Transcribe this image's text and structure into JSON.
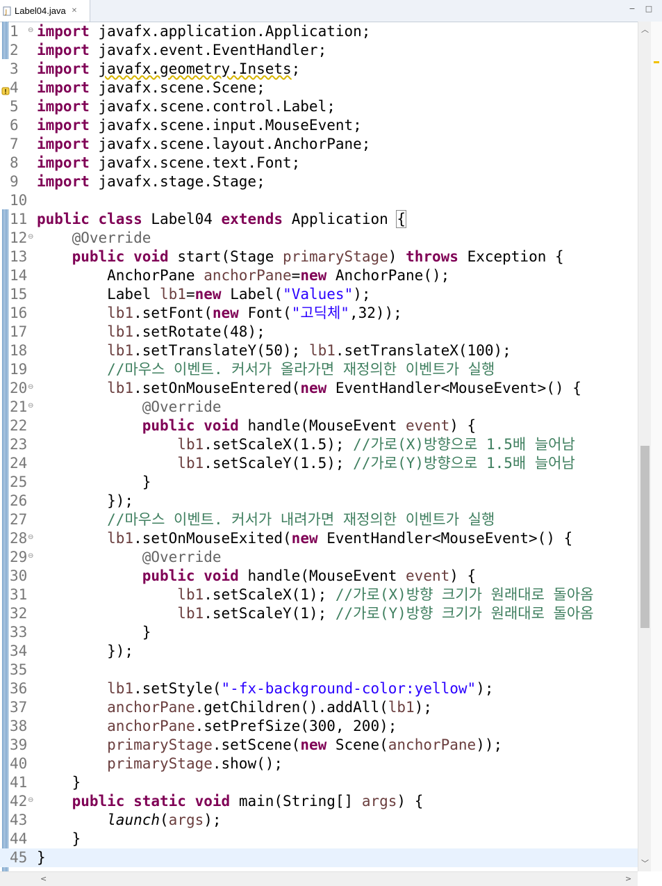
{
  "tab": {
    "title": "Label04.java",
    "close": "✕"
  },
  "window": {
    "minimize": "−",
    "maximize": "□"
  },
  "lines": [
    {
      "n": "1",
      "fold": "⊖",
      "html": "<span class=\"kw\">import</span> javafx.application.Application;"
    },
    {
      "n": "2",
      "fold": "",
      "html": "<span class=\"kw\">import</span> javafx.event.EventHandler;"
    },
    {
      "n": "3",
      "fold": "",
      "html": "<span class=\"kw\">import</span> <span style=\"text-decoration:underline wavy #d7b500\">javafx.geometry.Insets</span>;"
    },
    {
      "n": "4",
      "fold": "",
      "html": "<span class=\"kw\">import</span> javafx.scene.Scene;"
    },
    {
      "n": "5",
      "fold": "",
      "html": "<span class=\"kw\">import</span> javafx.scene.control.Label;"
    },
    {
      "n": "6",
      "fold": "",
      "html": "<span class=\"kw\">import</span> javafx.scene.input.MouseEvent;"
    },
    {
      "n": "7",
      "fold": "",
      "html": "<span class=\"kw\">import</span> javafx.scene.layout.AnchorPane;"
    },
    {
      "n": "8",
      "fold": "",
      "html": "<span class=\"kw\">import</span> javafx.scene.text.Font;"
    },
    {
      "n": "9",
      "fold": "",
      "html": "<span class=\"kw\">import</span> javafx.stage.Stage;"
    },
    {
      "n": "10",
      "fold": "",
      "html": ""
    },
    {
      "n": "11",
      "fold": "",
      "html": "<span class=\"kw\">public</span> <span class=\"kw\">class</span> Label04 <span class=\"kw\">extends</span> Application <span style=\"outline:1px solid #888\">{</span>"
    },
    {
      "n": "12",
      "fold": "⊖",
      "html": "    <span class=\"ann\">@Override</span>"
    },
    {
      "n": "13",
      "fold": "",
      "html": "    <span class=\"kw\">public</span> <span class=\"kw\">void</span> start(Stage <span class=\"fld\">primaryStage</span>) <span class=\"kw\">throws</span> Exception {"
    },
    {
      "n": "14",
      "fold": "",
      "html": "        AnchorPane <span class=\"fld\">anchorPane</span>=<span class=\"kw\">new</span> AnchorPane();"
    },
    {
      "n": "15",
      "fold": "",
      "html": "        Label <span class=\"fld\">lb1</span>=<span class=\"kw\">new</span> Label(<span class=\"str\">\"Values\"</span>);"
    },
    {
      "n": "16",
      "fold": "",
      "html": "        <span class=\"fld\">lb1</span>.setFont(<span class=\"kw\">new</span> Font(<span class=\"str\">\"고딕체\"</span>,32));"
    },
    {
      "n": "17",
      "fold": "",
      "html": "        <span class=\"fld\">lb1</span>.setRotate(48);"
    },
    {
      "n": "18",
      "fold": "",
      "html": "        <span class=\"fld\">lb1</span>.setTranslateY(50); <span class=\"fld\">lb1</span>.setTranslateX(100);"
    },
    {
      "n": "19",
      "fold": "",
      "html": "        <span class=\"cm\">//마우스 이벤트. 커서가 올라가면 재정의한 이벤트가 실행</span>"
    },
    {
      "n": "20",
      "fold": "⊖",
      "html": "        <span class=\"fld\">lb1</span>.setOnMouseEntered(<span class=\"kw\">new</span> EventHandler&lt;MouseEvent&gt;() {"
    },
    {
      "n": "21",
      "fold": "⊖",
      "html": "            <span class=\"ann\">@Override</span>"
    },
    {
      "n": "22",
      "fold": "",
      "html": "            <span class=\"kw\">public</span> <span class=\"kw\">void</span> handle(MouseEvent <span class=\"fld\">event</span>) {"
    },
    {
      "n": "23",
      "fold": "",
      "html": "                <span class=\"fld\">lb1</span>.setScaleX(1.5); <span class=\"cm\">//가로(X)방향으로 1.5배 늘어남</span>"
    },
    {
      "n": "24",
      "fold": "",
      "html": "                <span class=\"fld\">lb1</span>.setScaleY(1.5); <span class=\"cm\">//가로(Y)방향으로 1.5배 늘어남</span>"
    },
    {
      "n": "25",
      "fold": "",
      "html": "            }"
    },
    {
      "n": "26",
      "fold": "",
      "html": "        });"
    },
    {
      "n": "27",
      "fold": "",
      "html": "        <span class=\"cm\">//마우스 이벤트. 커서가 내려가면 재정의한 이벤트가 실행</span>"
    },
    {
      "n": "28",
      "fold": "⊖",
      "html": "        <span class=\"fld\">lb1</span>.setOnMouseExited(<span class=\"kw\">new</span> EventHandler&lt;MouseEvent&gt;() {"
    },
    {
      "n": "29",
      "fold": "⊖",
      "html": "            <span class=\"ann\">@Override</span>"
    },
    {
      "n": "30",
      "fold": "",
      "html": "            <span class=\"kw\">public</span> <span class=\"kw\">void</span> handle(MouseEvent <span class=\"fld\">event</span>) {"
    },
    {
      "n": "31",
      "fold": "",
      "html": "                <span class=\"fld\">lb1</span>.setScaleX(1); <span class=\"cm\">//가로(X)방향 크기가 원래대로 돌아옴</span>"
    },
    {
      "n": "32",
      "fold": "",
      "html": "                <span class=\"fld\">lb1</span>.setScaleY(1); <span class=\"cm\">//가로(Y)방향 크기가 원래대로 돌아옴</span>"
    },
    {
      "n": "33",
      "fold": "",
      "html": "            }"
    },
    {
      "n": "34",
      "fold": "",
      "html": "        });"
    },
    {
      "n": "35",
      "fold": "",
      "html": ""
    },
    {
      "n": "36",
      "fold": "",
      "html": "        <span class=\"fld\">lb1</span>.setStyle(<span class=\"str\">\"-fx-background-color:yellow\"</span>);"
    },
    {
      "n": "37",
      "fold": "",
      "html": "        <span class=\"fld\">anchorPane</span>.getChildren().addAll(<span class=\"fld\">lb1</span>);"
    },
    {
      "n": "38",
      "fold": "",
      "html": "        <span class=\"fld\">anchorPane</span>.setPrefSize(300, 200);"
    },
    {
      "n": "39",
      "fold": "",
      "html": "        <span class=\"fld\">primaryStage</span>.setScene(<span class=\"kw\">new</span> Scene(<span class=\"fld\">anchorPane</span>));"
    },
    {
      "n": "40",
      "fold": "",
      "html": "        <span class=\"fld\">primaryStage</span>.show();"
    },
    {
      "n": "41",
      "fold": "",
      "html": "    }"
    },
    {
      "n": "42",
      "fold": "⊖",
      "html": "    <span class=\"kw\">public</span> <span class=\"kw\">static</span> <span class=\"kw\">void</span> main(String[] <span class=\"fld\">args</span>) {"
    },
    {
      "n": "43",
      "fold": "",
      "html": "        <span class=\"it\">launch</span>(<span class=\"fld\">args</span>);"
    },
    {
      "n": "44",
      "fold": "",
      "html": "    }"
    },
    {
      "n": "45",
      "fold": "",
      "html": "}"
    }
  ],
  "current_line": "45"
}
